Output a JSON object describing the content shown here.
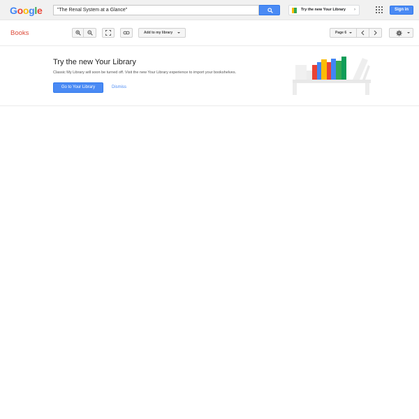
{
  "header": {
    "logo_letters": [
      "G",
      "o",
      "o",
      "g",
      "l",
      "e"
    ],
    "logo_colors": [
      "#4285f4",
      "#ea4335",
      "#fbbc05",
      "#4285f4",
      "#34a853",
      "#ea4335"
    ],
    "search_value": "\"The Renal System at a Glance\"",
    "promo_label": "Try the new Your Library",
    "signin_label": "Sign in",
    "accent_color": "#4a8af4"
  },
  "toolbar": {
    "section_title": "Books",
    "add_to_library_label": "Add to my library",
    "page_label": "Page 6",
    "icons": [
      "zoom-in-icon",
      "zoom-out-icon",
      "fullscreen-icon",
      "link-icon",
      "chevron-left-icon",
      "chevron-right-icon",
      "gear-icon"
    ]
  },
  "library_panel": {
    "title": "Try the new Your Library",
    "description": "Classic My Library will soon be turned off. Visit the new Your Library experience to import your bookshelves.",
    "primary_button": "Go to Your Library",
    "dismiss_label": "Dismiss"
  }
}
